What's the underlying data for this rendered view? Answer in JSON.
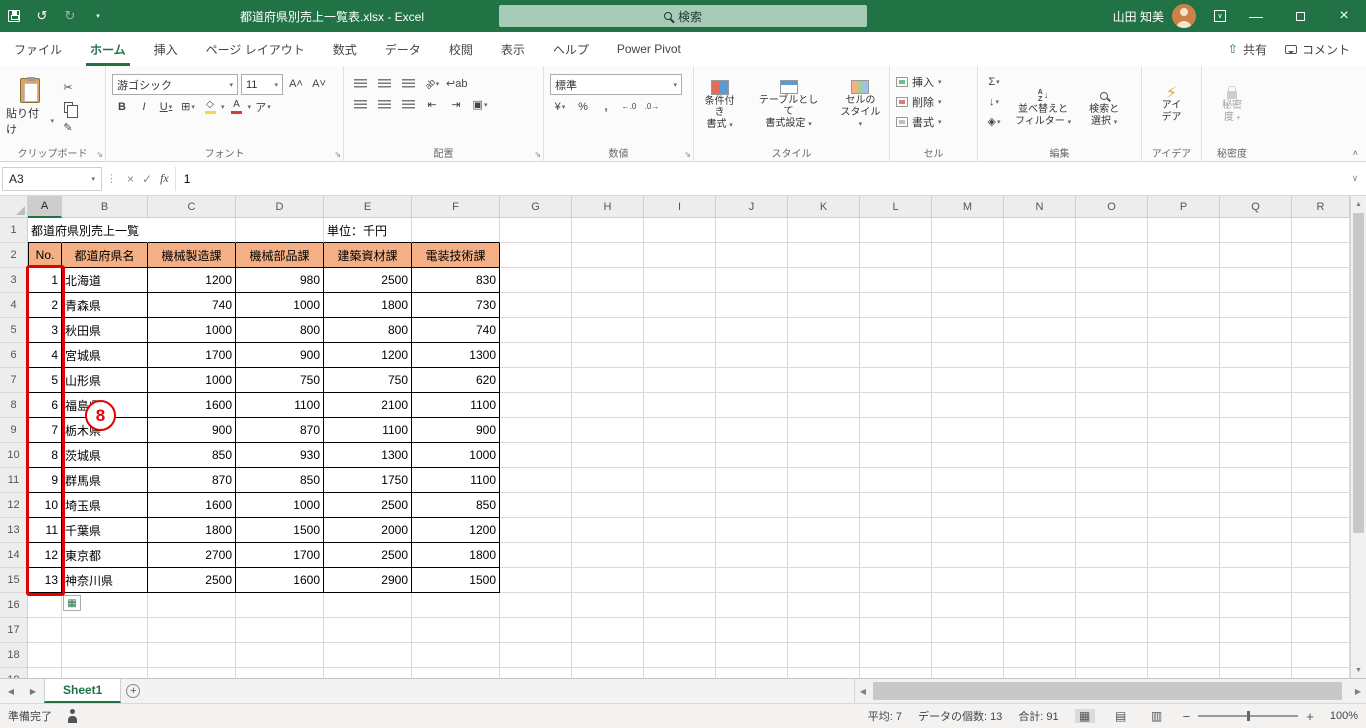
{
  "colors": {
    "accent": "#217346",
    "titlebar": "#217346",
    "header_fill": "#F4B084",
    "annotation_red": "#E30000",
    "search_pill": "#A8CBB8",
    "avatar_bg": "#CE8147"
  },
  "titlebar": {
    "filename": "都道府県別売上一覧表.xlsx - Excel",
    "search": "検索",
    "user": "山田 知美"
  },
  "tabs": {
    "file": "ファイル",
    "items": [
      "ホーム",
      "挿入",
      "ページ レイアウト",
      "数式",
      "データ",
      "校閲",
      "表示",
      "ヘルプ",
      "Power Pivot"
    ],
    "active": "ホーム",
    "share": "共有",
    "comments": "コメント"
  },
  "ribbon": {
    "paste": "貼り付け",
    "font_name": "游ゴシック",
    "font_size": "11",
    "number_format": "標準",
    "styles_buttons": {
      "conditional_l1": "条件付き",
      "conditional_l2": "書式",
      "table_l1": "テーブルとして",
      "table_l2": "書式設定",
      "cell_l1": "セルの",
      "cell_l2": "スタイル"
    },
    "cells_buttons": {
      "insert": "挿入",
      "delete": "削除",
      "format": "書式"
    },
    "editing_buttons": {
      "sort_l1": "並べ替えと",
      "sort_l2": "フィルター",
      "find_l1": "検索と",
      "find_l2": "選択"
    },
    "ideas_l1": "アイ",
    "ideas_l2": "デア",
    "sensitivity_l1": "秘密",
    "sensitivity_l2": "度",
    "group_labels": {
      "clipboard": "クリップボード",
      "font": "フォント",
      "alignment": "配置",
      "number": "数値",
      "styles": "スタイル",
      "cells": "セル",
      "editing": "編集",
      "ideas": "アイデア",
      "sensitivity": "秘密度"
    }
  },
  "formula_bar": {
    "name_box": "A3",
    "fx": "fx",
    "value": "1"
  },
  "sheet": {
    "columns": [
      "A",
      "B",
      "C",
      "D",
      "E",
      "F",
      "G",
      "H",
      "I",
      "J",
      "K",
      "L",
      "M",
      "N",
      "O",
      "P",
      "Q",
      "R"
    ],
    "selected_column": "A",
    "title_cell": "都道府県別売上一覧",
    "unit_cell": "単位：千円",
    "header_fill": "#F4B084",
    "header_row": [
      "No.",
      "都道府県名",
      "機械製造課",
      "機械部品課",
      "建築資材課",
      "電装技術課"
    ],
    "data_rows": [
      [
        "1",
        "北海道",
        "1200",
        "980",
        "2500",
        "830"
      ],
      [
        "2",
        "青森県",
        "740",
        "1000",
        "1800",
        "730"
      ],
      [
        "3",
        "秋田県",
        "1000",
        "800",
        "800",
        "740"
      ],
      [
        "4",
        "宮城県",
        "1700",
        "900",
        "1200",
        "1300"
      ],
      [
        "5",
        "山形県",
        "1000",
        "750",
        "750",
        "620"
      ],
      [
        "6",
        "福島県",
        "1600",
        "1100",
        "2100",
        "1100"
      ],
      [
        "7",
        "栃木県",
        "900",
        "870",
        "1100",
        "900"
      ],
      [
        "8",
        "茨城県",
        "850",
        "930",
        "1300",
        "1000"
      ],
      [
        "9",
        "群馬県",
        "870",
        "850",
        "1750",
        "1100"
      ],
      [
        "10",
        "埼玉県",
        "1600",
        "1000",
        "2500",
        "850"
      ],
      [
        "11",
        "千葉県",
        "1800",
        "1500",
        "2000",
        "1200"
      ],
      [
        "12",
        "東京都",
        "2700",
        "1700",
        "2500",
        "1800"
      ],
      [
        "13",
        "神奈川県",
        "2500",
        "1600",
        "2900",
        "1500"
      ]
    ]
  },
  "sheet_tabs": {
    "active": "Sheet1"
  },
  "status_bar": {
    "mode": "準備完了",
    "average": "平均: 7",
    "count": "データの個数: 13",
    "sum": "合計: 91",
    "zoom": "100%"
  },
  "annotation": {
    "badge": "8"
  }
}
